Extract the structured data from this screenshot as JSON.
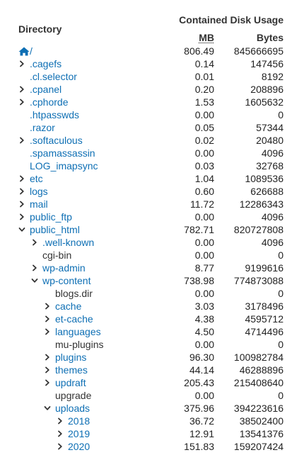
{
  "header": {
    "directory_label": "Directory",
    "contained_label": "Contained Disk Usage",
    "mb_label": "MB",
    "bytes_label": "Bytes"
  },
  "colors": {
    "link": "#0e6fb4",
    "text": "#333333"
  },
  "rows": [
    {
      "label": "/",
      "mb": "806.49",
      "bytes": "845666695",
      "depth": 0,
      "chevron": "home"
    },
    {
      "label": ".cagefs",
      "mb": "0.14",
      "bytes": "147456",
      "depth": 0,
      "chevron": "right"
    },
    {
      "label": ".cl.selector",
      "mb": "0.01",
      "bytes": "8192",
      "depth": 0,
      "chevron": "none"
    },
    {
      "label": ".cpanel",
      "mb": "0.20",
      "bytes": "208896",
      "depth": 0,
      "chevron": "right"
    },
    {
      "label": ".cphorde",
      "mb": "1.53",
      "bytes": "1605632",
      "depth": 0,
      "chevron": "right"
    },
    {
      "label": ".htpasswds",
      "mb": "0.00",
      "bytes": "0",
      "depth": 0,
      "chevron": "none"
    },
    {
      "label": ".razor",
      "mb": "0.05",
      "bytes": "57344",
      "depth": 0,
      "chevron": "none"
    },
    {
      "label": ".softaculous",
      "mb": "0.02",
      "bytes": "20480",
      "depth": 0,
      "chevron": "right"
    },
    {
      "label": ".spamassassin",
      "mb": "0.00",
      "bytes": "4096",
      "depth": 0,
      "chevron": "none"
    },
    {
      "label": "LOG_imapsync",
      "mb": "0.03",
      "bytes": "32768",
      "depth": 0,
      "chevron": "none"
    },
    {
      "label": "etc",
      "mb": "1.04",
      "bytes": "1089536",
      "depth": 0,
      "chevron": "right"
    },
    {
      "label": "logs",
      "mb": "0.60",
      "bytes": "626688",
      "depth": 0,
      "chevron": "right"
    },
    {
      "label": "mail",
      "mb": "11.72",
      "bytes": "12286343",
      "depth": 0,
      "chevron": "right"
    },
    {
      "label": "public_ftp",
      "mb": "0.00",
      "bytes": "4096",
      "depth": 0,
      "chevron": "right"
    },
    {
      "label": "public_html",
      "mb": "782.71",
      "bytes": "820727808",
      "depth": 0,
      "chevron": "down"
    },
    {
      "label": ".well-known",
      "mb": "0.00",
      "bytes": "4096",
      "depth": 1,
      "chevron": "right"
    },
    {
      "label": "cgi-bin",
      "mb": "0.00",
      "bytes": "0",
      "depth": 1,
      "chevron": "none",
      "plain": true
    },
    {
      "label": "wp-admin",
      "mb": "8.77",
      "bytes": "9199616",
      "depth": 1,
      "chevron": "right"
    },
    {
      "label": "wp-content",
      "mb": "738.98",
      "bytes": "774873088",
      "depth": 1,
      "chevron": "down"
    },
    {
      "label": "blogs.dir",
      "mb": "0.00",
      "bytes": "0",
      "depth": 2,
      "chevron": "none",
      "plain": true
    },
    {
      "label": "cache",
      "mb": "3.03",
      "bytes": "3178496",
      "depth": 2,
      "chevron": "right"
    },
    {
      "label": "et-cache",
      "mb": "4.38",
      "bytes": "4595712",
      "depth": 2,
      "chevron": "right"
    },
    {
      "label": "languages",
      "mb": "4.50",
      "bytes": "4714496",
      "depth": 2,
      "chevron": "right"
    },
    {
      "label": "mu-plugins",
      "mb": "0.00",
      "bytes": "0",
      "depth": 2,
      "chevron": "none",
      "plain": true
    },
    {
      "label": "plugins",
      "mb": "96.30",
      "bytes": "100982784",
      "depth": 2,
      "chevron": "right"
    },
    {
      "label": "themes",
      "mb": "44.14",
      "bytes": "46288896",
      "depth": 2,
      "chevron": "right"
    },
    {
      "label": "updraft",
      "mb": "205.43",
      "bytes": "215408640",
      "depth": 2,
      "chevron": "right"
    },
    {
      "label": "upgrade",
      "mb": "0.00",
      "bytes": "0",
      "depth": 2,
      "chevron": "none",
      "plain": true
    },
    {
      "label": "uploads",
      "mb": "375.96",
      "bytes": "394223616",
      "depth": 2,
      "chevron": "down"
    },
    {
      "label": "2018",
      "mb": "36.72",
      "bytes": "38502400",
      "depth": 3,
      "chevron": "right"
    },
    {
      "label": "2019",
      "mb": "12.91",
      "bytes": "13541376",
      "depth": 3,
      "chevron": "right"
    },
    {
      "label": "2020",
      "mb": "151.83",
      "bytes": "159207424",
      "depth": 3,
      "chevron": "right"
    }
  ]
}
